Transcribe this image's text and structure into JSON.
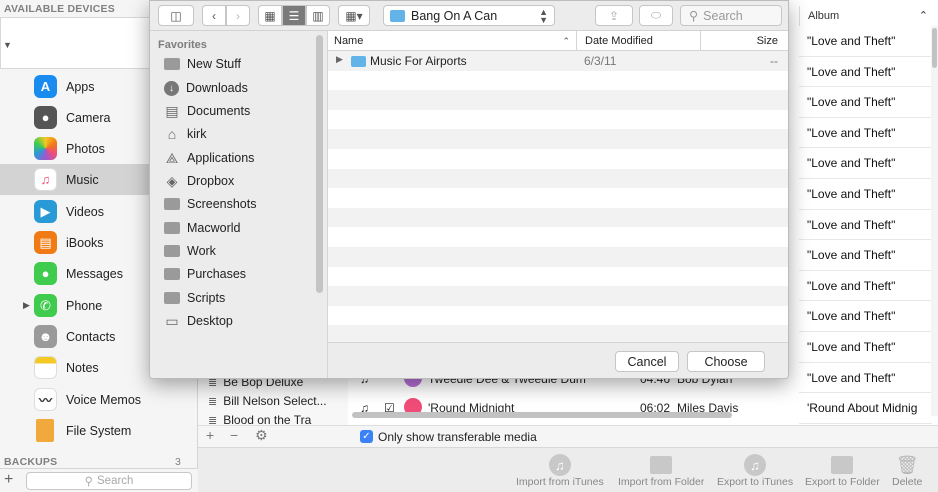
{
  "sidebar": {
    "devices_title": "AVAILABLE DEVICES",
    "items": [
      {
        "label": "Apps",
        "icon": "apps-icon",
        "color": "#1a8cf0"
      },
      {
        "label": "Camera",
        "icon": "camera-icon",
        "color": "#555555"
      },
      {
        "label": "Photos",
        "icon": "photos-icon",
        "color": "#f2a93b"
      },
      {
        "label": "Music",
        "icon": "music-icon",
        "color": "#f04c78"
      },
      {
        "label": "Videos",
        "icon": "videos-icon",
        "color": "#2a9ad6"
      },
      {
        "label": "iBooks",
        "icon": "ibooks-icon",
        "color": "#f07b15"
      },
      {
        "label": "Messages",
        "icon": "messages-icon",
        "color": "#3fcc4e"
      },
      {
        "label": "Phone",
        "icon": "phone-icon",
        "color": "#3fcc4e"
      },
      {
        "label": "Contacts",
        "icon": "contacts-icon",
        "color": "#9a9a9a"
      },
      {
        "label": "Notes",
        "icon": "notes-icon",
        "color": "#f5c924"
      },
      {
        "label": "Voice Memos",
        "icon": "voice-memos-icon",
        "color": "#333333"
      },
      {
        "label": "File System",
        "icon": "file-system-icon",
        "color": "#f2a93b"
      }
    ],
    "backups_title": "BACKUPS",
    "backups_count": "3",
    "search_placeholder": "Search"
  },
  "dialog": {
    "path": "Bang On A Can",
    "search_placeholder": "Search",
    "favorites_title": "Favorites",
    "favorites": [
      {
        "label": "New Stuff",
        "icon": "folder-icon"
      },
      {
        "label": "Downloads",
        "icon": "downloads-icon"
      },
      {
        "label": "Documents",
        "icon": "documents-icon"
      },
      {
        "label": "kirk",
        "icon": "home-icon"
      },
      {
        "label": "Applications",
        "icon": "applications-icon"
      },
      {
        "label": "Dropbox",
        "icon": "dropbox-icon"
      },
      {
        "label": "Screenshots",
        "icon": "folder-icon"
      },
      {
        "label": "Macworld",
        "icon": "folder-icon"
      },
      {
        "label": "Work",
        "icon": "folder-icon"
      },
      {
        "label": "Purchases",
        "icon": "folder-icon"
      },
      {
        "label": "Scripts",
        "icon": "folder-icon"
      },
      {
        "label": "Desktop",
        "icon": "desktop-icon"
      }
    ],
    "columns": {
      "name": "Name",
      "date": "Date Modified",
      "size": "Size"
    },
    "files": [
      {
        "name": "Music For Airports",
        "date": "6/3/11",
        "size": "--"
      }
    ],
    "cancel_label": "Cancel",
    "choose_label": "Choose"
  },
  "background": {
    "album_header": "Album",
    "albums": [
      "\"Love and Theft\"",
      "\"Love and Theft\"",
      "\"Love and Theft\"",
      "\"Love and Theft\"",
      "\"Love and Theft\"",
      "\"Love and Theft\"",
      "\"Love and Theft\"",
      "\"Love and Theft\"",
      "\"Love and Theft\"",
      "\"Love and Theft\"",
      "\"Love and Theft\"",
      "\"Love and Theft\"",
      "'Round About Midnig"
    ],
    "playlists": [
      "Be Bop Deluxe",
      "Bill Nelson Select...",
      "Blood on the Tra"
    ],
    "songs": [
      {
        "title": "Tweedle Dee & Tweedle Dum",
        "time": "04:46",
        "artist": "Bob Dylan"
      },
      {
        "title": "'Round Midnight",
        "time": "06:02",
        "artist": "Miles Davis"
      }
    ],
    "only_transferable": "Only show transferable media",
    "actions": [
      "Import from iTunes",
      "Import from Folder",
      "Export to iTunes",
      "Export to Folder",
      "Delete"
    ]
  }
}
